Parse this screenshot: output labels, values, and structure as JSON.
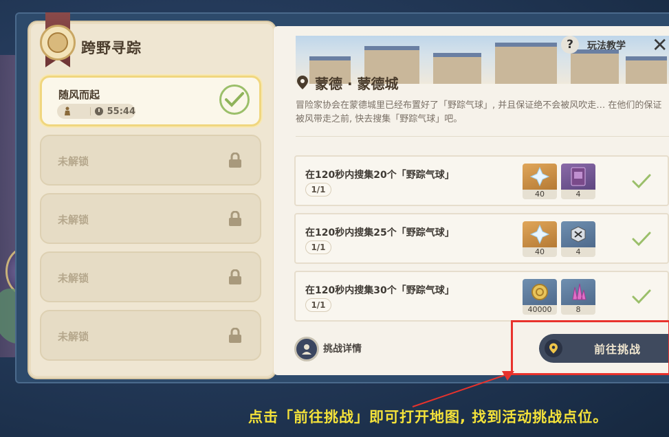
{
  "event": {
    "title": "跨野寻踪",
    "stages": [
      {
        "name": "随风而起",
        "time": "55:44",
        "completed": true
      },
      {
        "name": "未解锁",
        "locked": true
      },
      {
        "name": "未解锁",
        "locked": true
      },
      {
        "name": "未解锁",
        "locked": true
      },
      {
        "name": "未解锁",
        "locked": true
      }
    ]
  },
  "header": {
    "help_label": "玩法教学",
    "help_glyph": "?",
    "close_glyph": "✕"
  },
  "location": {
    "title": "蒙德 · 蒙德城",
    "description": "冒险家协会在蒙德城里已经布置好了「野踪气球」, 并且保证绝不会被风吹走… 在他们的保证被风带走之前, 快去搜集「野踪气球」吧。"
  },
  "tasks": [
    {
      "text": "在120秒内搜集20个「野踪气球」",
      "progress": "1/1",
      "rewards": [
        {
          "qty": "40",
          "icon": "primogem-icon"
        },
        {
          "qty": "4",
          "icon": "hero-wit-book-icon"
        }
      ],
      "done": true
    },
    {
      "text": "在120秒内搜集25个「野踪气球」",
      "progress": "1/1",
      "rewards": [
        {
          "qty": "40",
          "icon": "primogem-icon"
        },
        {
          "qty": "4",
          "icon": "mystic-enhancement-ore-icon"
        }
      ],
      "done": true
    },
    {
      "text": "在120秒内搜集30个「野踪气球」",
      "progress": "1/1",
      "rewards": [
        {
          "qty": "40000",
          "icon": "mora-icon"
        },
        {
          "qty": "8",
          "icon": "crystal-icon"
        }
      ],
      "done": true
    }
  ],
  "footer": {
    "details_label": "挑战详情",
    "go_label": "前往挑战"
  },
  "caption": "点击「前往挑战」即可打开地图, 找到活动挑战点位。",
  "colors": {
    "highlight": "#e8322c",
    "caption": "#f4e23a",
    "check": "#9bbf6a"
  }
}
